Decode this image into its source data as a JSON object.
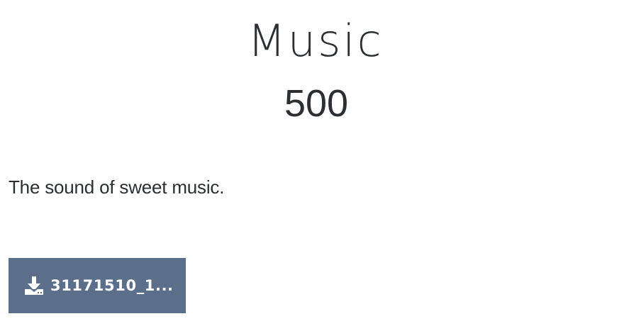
{
  "product": {
    "title": "Music",
    "price": "500",
    "description": "The sound of sweet music."
  },
  "download": {
    "label": "31171510_1...",
    "icon": "download-icon",
    "button_color": "#5b6f8b"
  }
}
